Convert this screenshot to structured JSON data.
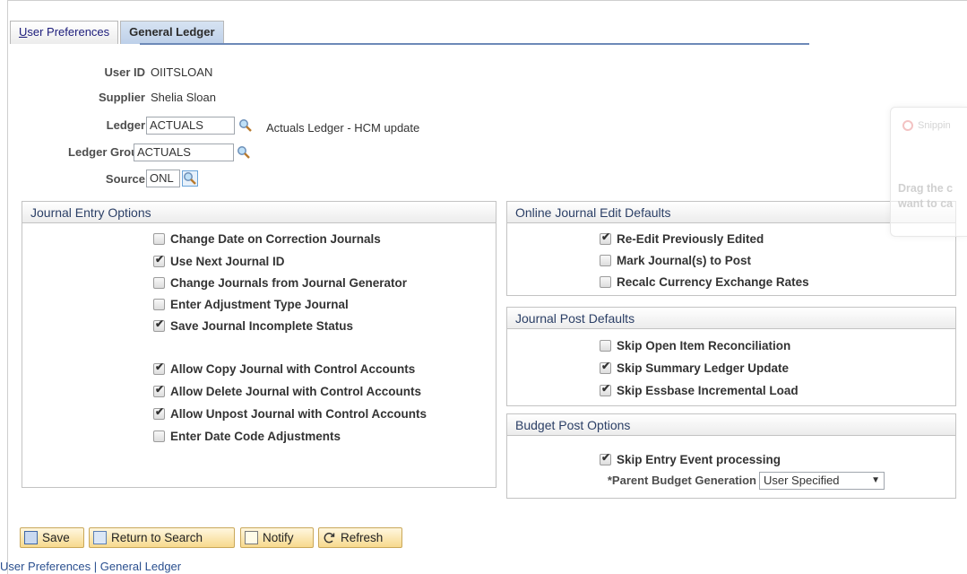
{
  "tabs": [
    {
      "label": "User Preferences",
      "accel": "U",
      "rest": "ser Preferences"
    },
    {
      "label": "General Ledger"
    }
  ],
  "header": {
    "user_id_label": "User ID",
    "user_id": "OIITSLOAN",
    "supplier_label": "Supplier",
    "supplier": "Shelia Sloan",
    "ledger_label": "Ledger",
    "ledger": "ACTUALS",
    "ledger_desc": "Actuals Ledger - HCM update",
    "ledger_group_label": "Ledger Group",
    "ledger_group": "ACTUALS",
    "source_label": "Source",
    "source": "ONL"
  },
  "journal_entry": {
    "title": "Journal Entry Options",
    "options": [
      {
        "label": "Change Date on Correction Journals",
        "checked": false
      },
      {
        "label": "Use Next Journal ID",
        "checked": true
      },
      {
        "label": "Change Journals from Journal Generator",
        "checked": false
      },
      {
        "label": "Enter Adjustment Type Journal",
        "checked": false
      },
      {
        "label": "Save Journal Incomplete Status",
        "checked": true
      },
      {
        "label": "Allow Copy Journal with Control Accounts",
        "checked": true
      },
      {
        "label": "Allow Delete Journal with Control Accounts",
        "checked": true
      },
      {
        "label": "Allow Unpost Journal with Control Accounts",
        "checked": true
      },
      {
        "label": "Enter Date Code Adjustments",
        "checked": false
      }
    ]
  },
  "edit_defaults": {
    "title": "Online Journal Edit Defaults",
    "options": [
      {
        "label": "Re-Edit Previously Edited",
        "checked": true
      },
      {
        "label": "Mark Journal(s) to Post",
        "checked": false
      },
      {
        "label": "Recalc Currency Exchange Rates",
        "checked": false
      }
    ]
  },
  "post_defaults": {
    "title": "Journal Post Defaults",
    "options": [
      {
        "label": "Skip Open Item Reconciliation",
        "checked": false
      },
      {
        "label": "Skip Summary Ledger Update",
        "checked": true
      },
      {
        "label": "Skip Essbase Incremental Load",
        "checked": true
      }
    ]
  },
  "budget_post": {
    "title": "Budget Post Options",
    "skip_entry_event": {
      "label": "Skip Entry Event processing",
      "checked": true
    },
    "parent_gen_label": "*Parent Budget Generation",
    "parent_gen_value": "User Specified"
  },
  "toolbar": {
    "save": "Save",
    "return": "Return to Search",
    "notify": "Notify",
    "refresh": "Refresh"
  },
  "footer": {
    "link1": "User Preferences",
    "sep": " | ",
    "link2": "General Ledger"
  },
  "snip_overlay": {
    "title": "Snippin",
    "body1": "Drag the c",
    "body2": "want to ca"
  }
}
